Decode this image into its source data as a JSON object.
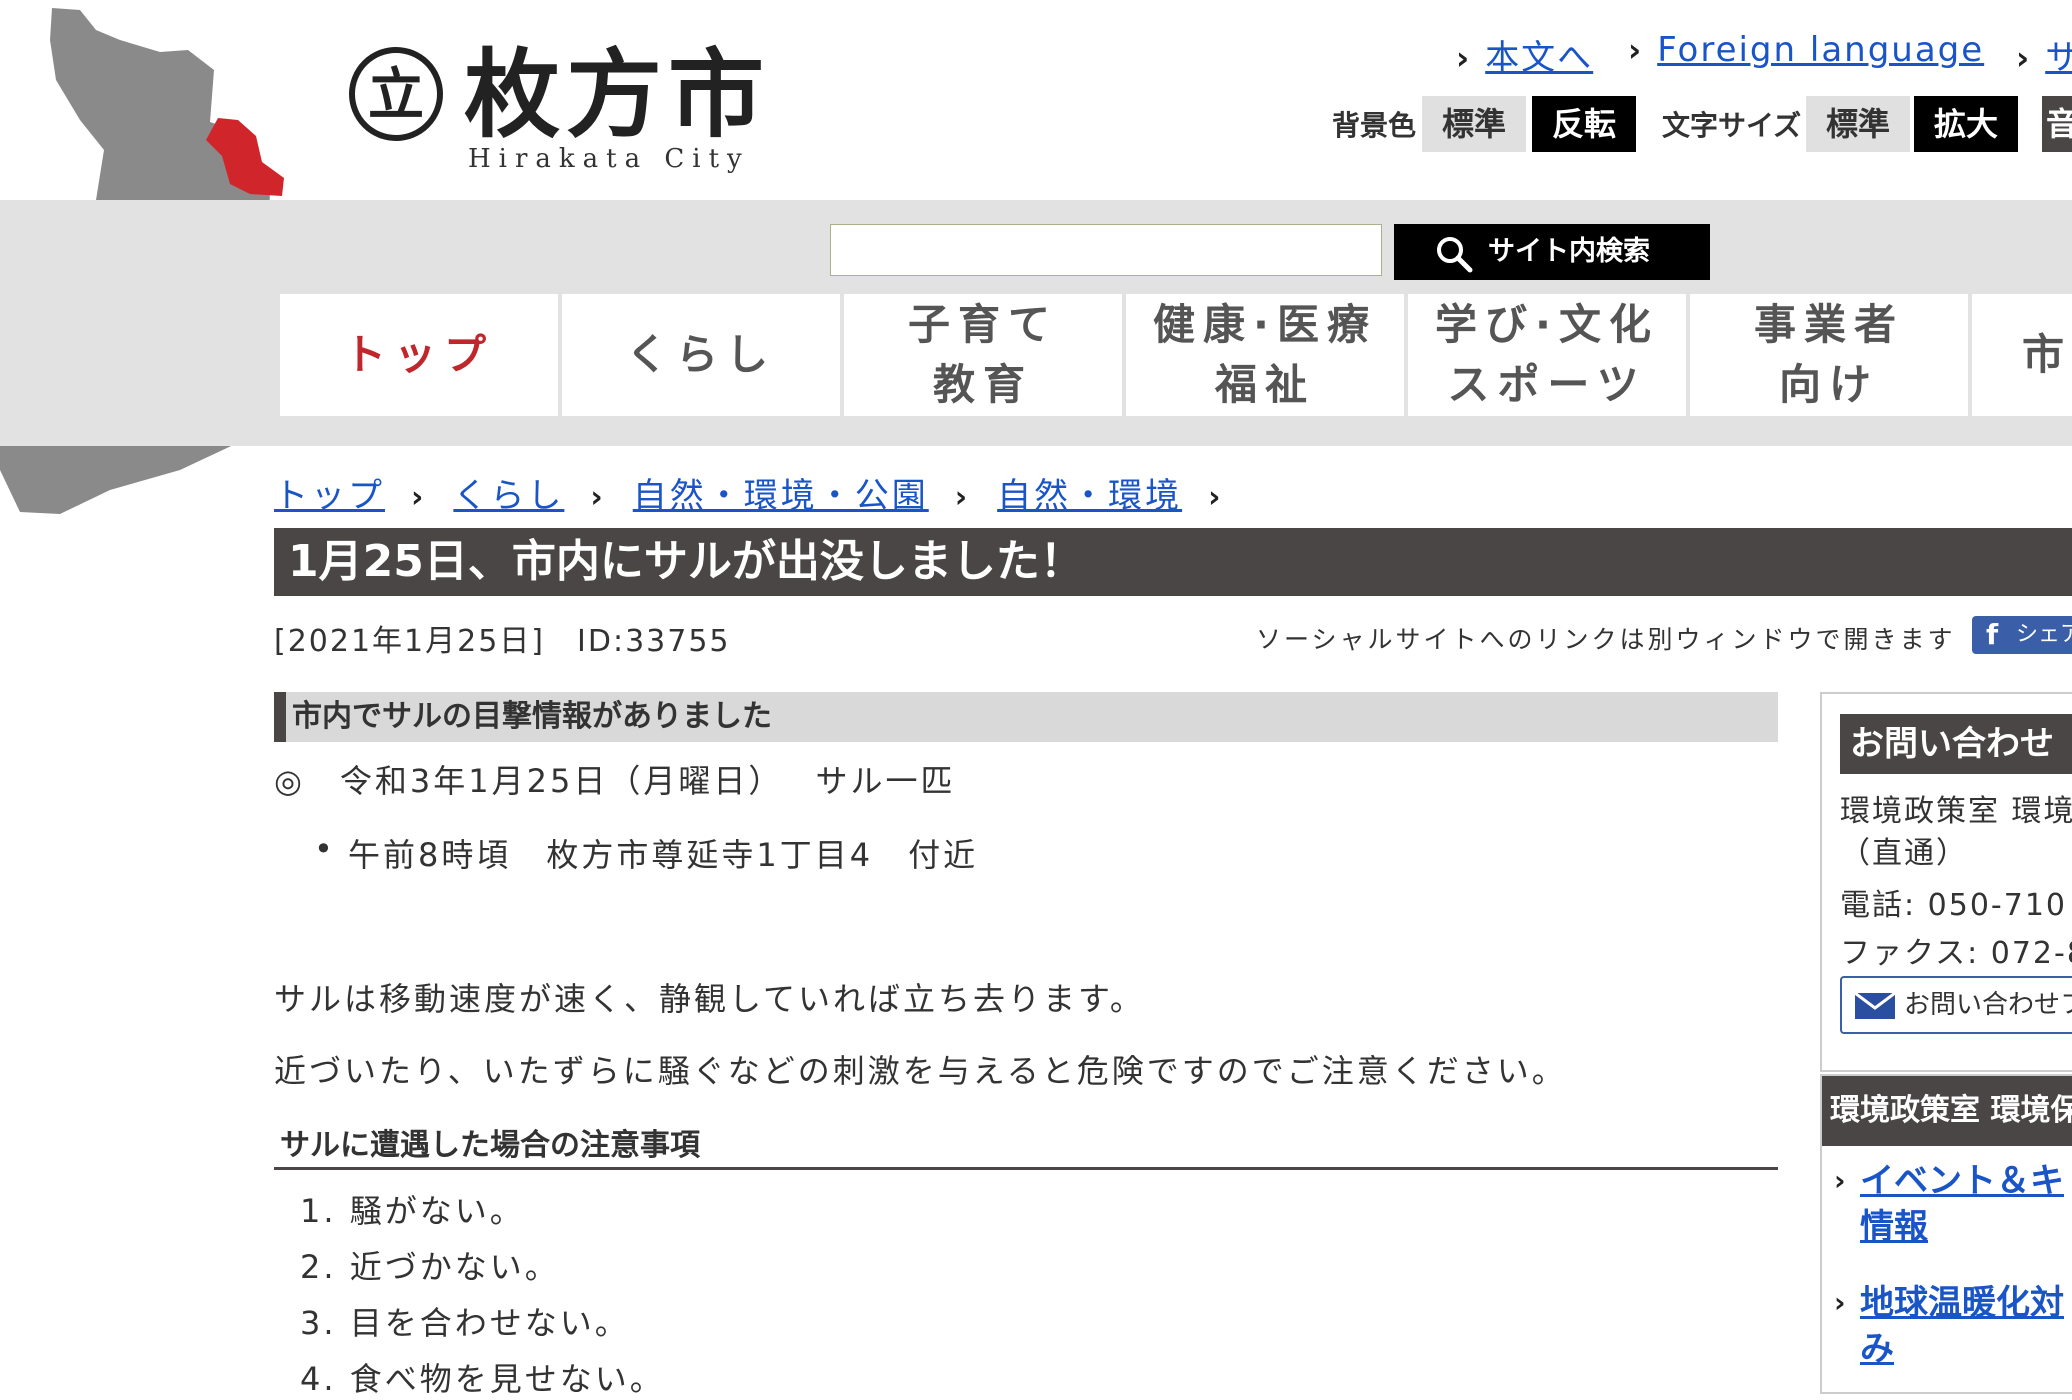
{
  "header": {
    "city_name": "枚方市",
    "city_name_roman": "Hirakata City",
    "logo_mark": "立",
    "links": {
      "chevron": "›",
      "skip_to_content": "本文へ",
      "foreign_language": "Foreign language",
      "partial": "サ"
    },
    "background": {
      "label": "背景色",
      "standard": "標準",
      "inverted": "反転"
    },
    "text_size": {
      "label": "文字サイズ",
      "standard": "標準",
      "enlarge": "拡大"
    },
    "partial_button": "音"
  },
  "search": {
    "value": "",
    "button_label": "サイト内検索"
  },
  "nav": {
    "items": [
      {
        "line1": "トップ",
        "line2": ""
      },
      {
        "line1": "くらし",
        "line2": ""
      },
      {
        "line1": "子育て",
        "line2": "教育"
      },
      {
        "line1": "健康·医療",
        "line2": "福祉"
      },
      {
        "line1": "学び·文化",
        "line2": "スポーツ"
      },
      {
        "line1": "事業者",
        "line2": "向け"
      },
      {
        "line1": "市政",
        "line2": ""
      }
    ]
  },
  "breadcrumb": {
    "separator": "›",
    "items": [
      "トップ",
      "くらし",
      "自然・環境・公園",
      "自然・環境"
    ]
  },
  "page": {
    "title": "1月25日、市内にサルが出没しました！",
    "date_id": "[2021年1月25日]　ID:33755",
    "social_note": "ソーシャルサイトへのリンクは別ウィンドウで開きます",
    "share_label": "シェア",
    "share_icon": "f"
  },
  "content": {
    "section_heading": "市内でサルの目撃情報がありました",
    "sighting_line": "◎　令和3年1月25日（月曜日）　 サル一匹",
    "sighting_bullet": "•",
    "sighting_detail": "午前8時頃　枚方市尊延寺1丁目4　付近",
    "para1": "サルは移動速度が速く、静観していれば立ち去ります。",
    "para2": "近づいたり、いたずらに騒ぐなどの刺激を与えると危険ですのでご注意ください。",
    "sub_heading": "サルに遭遇した場合の注意事項",
    "precautions": [
      "1. 騒がない。",
      "2. 近づかない。",
      "3. 目を合わせない。",
      "4. 食べ物を見せない。"
    ]
  },
  "sidebar": {
    "contact_title": "お問い合わせ",
    "contact_dept": "環境政策室 環境",
    "contact_direct": "（直通）",
    "phone": "電話: 050-710",
    "fax": "ファクス: 072-8",
    "form_button": "お問い合わせフ",
    "dept_title": "環境政策室 環境保",
    "dept_chevron": "›",
    "dept_links": [
      {
        "line1": "イベント＆キ",
        "line2": "情報"
      },
      {
        "line1": "地球温暖化対",
        "line2": "み"
      }
    ]
  },
  "colors": {
    "accent_red": "#c0272d",
    "title_bar": "#4a4646",
    "link": "#1a55c8"
  }
}
